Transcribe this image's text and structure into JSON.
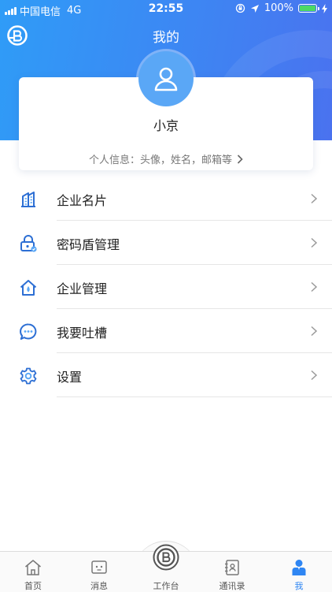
{
  "status_bar": {
    "carrier": "中国电信",
    "network": "4G",
    "time": "22:55",
    "battery": "100%"
  },
  "header": {
    "title": "我的",
    "logo_icon": "brand-b-logo"
  },
  "profile": {
    "name": "小京",
    "info_link": "个人信息：头像，姓名，邮箱等"
  },
  "menu": {
    "items": [
      {
        "label": "企业名片",
        "icon": "building-icon"
      },
      {
        "label": "密码盾管理",
        "icon": "lock-shield-icon"
      },
      {
        "label": "企业管理",
        "icon": "house-settings-icon"
      },
      {
        "label": "我要吐槽",
        "icon": "chat-bubble-icon"
      },
      {
        "label": "设置",
        "icon": "gear-icon"
      }
    ]
  },
  "tab_bar": {
    "tabs": [
      {
        "label": "首页",
        "icon": "home-icon"
      },
      {
        "label": "消息",
        "icon": "message-icon"
      },
      {
        "label": "工作台",
        "icon": "brand-b-logo"
      },
      {
        "label": "通讯录",
        "icon": "contacts-icon"
      },
      {
        "label": "我",
        "icon": "person-icon"
      }
    ],
    "active": "我"
  },
  "colors": {
    "accent": "#2f86f3",
    "header_start": "#2f9cf7",
    "header_end": "#4a72ef",
    "avatar_bg": "#5aa7f6",
    "battery": "#4cd964"
  }
}
